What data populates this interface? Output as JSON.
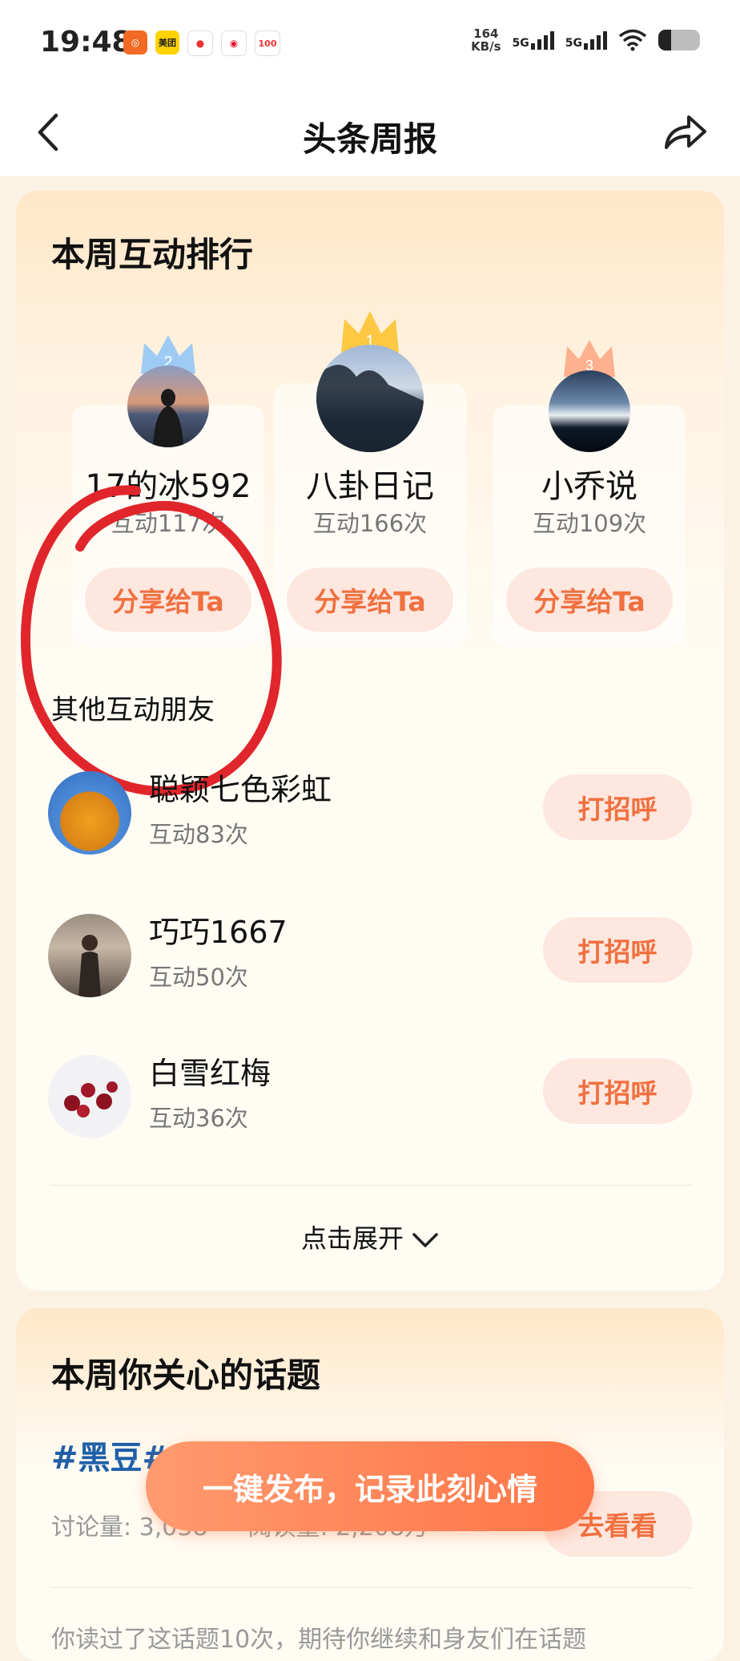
{
  "status_bar": {
    "time": "19:48",
    "app_icons": [
      "app-icon-orange",
      "meituan-icon",
      "maps-icon",
      "weibo-icon",
      "app-icon-100"
    ],
    "meituan_label": "美团",
    "icon_100_label": "100",
    "net_speed_value": "164",
    "net_speed_unit": "KB/s",
    "signal1_label": "5G",
    "signal2_label": "5G"
  },
  "nav": {
    "title": "头条周报",
    "back_icon": "chevron-left-icon",
    "share_icon": "share-arrow-icon"
  },
  "ranking": {
    "title": "本周互动排行",
    "top3": [
      {
        "rank": "2",
        "name": "17的冰592",
        "count": "互动117次",
        "button": "分享给Ta",
        "crown_color": "#9ecbf3"
      },
      {
        "rank": "1",
        "name": "八卦日记",
        "count": "互动166次",
        "button": "分享给Ta",
        "crown_color": "#ffc843"
      },
      {
        "rank": "3",
        "name": "小乔说",
        "count": "互动109次",
        "button": "分享给Ta",
        "crown_color": "#ffb08f"
      }
    ],
    "others_title": "其他互动朋友",
    "others": [
      {
        "name": "聪颖七色彩虹",
        "count": "互动83次",
        "button": "打招呼"
      },
      {
        "name": "巧巧1667",
        "count": "互动50次",
        "button": "打招呼"
      },
      {
        "name": "白雪红梅",
        "count": "互动36次",
        "button": "打招呼"
      }
    ],
    "expand_label": "点击展开"
  },
  "topics": {
    "title": "本周你关心的话题",
    "tag": "#黑豆#",
    "discuss": "讨论量: 3,038",
    "read": "阅读量: 2,208万",
    "button": "去看看",
    "hint": "你读过了这话题10次，期待你继续和身友们在话题"
  },
  "float_button": "一键发布，记录此刻心情",
  "colors": {
    "accent": "#f0703f",
    "button_bg": "#fde7df",
    "topic_blue": "#1f5fa8",
    "annotation_red": "#e0262b"
  }
}
